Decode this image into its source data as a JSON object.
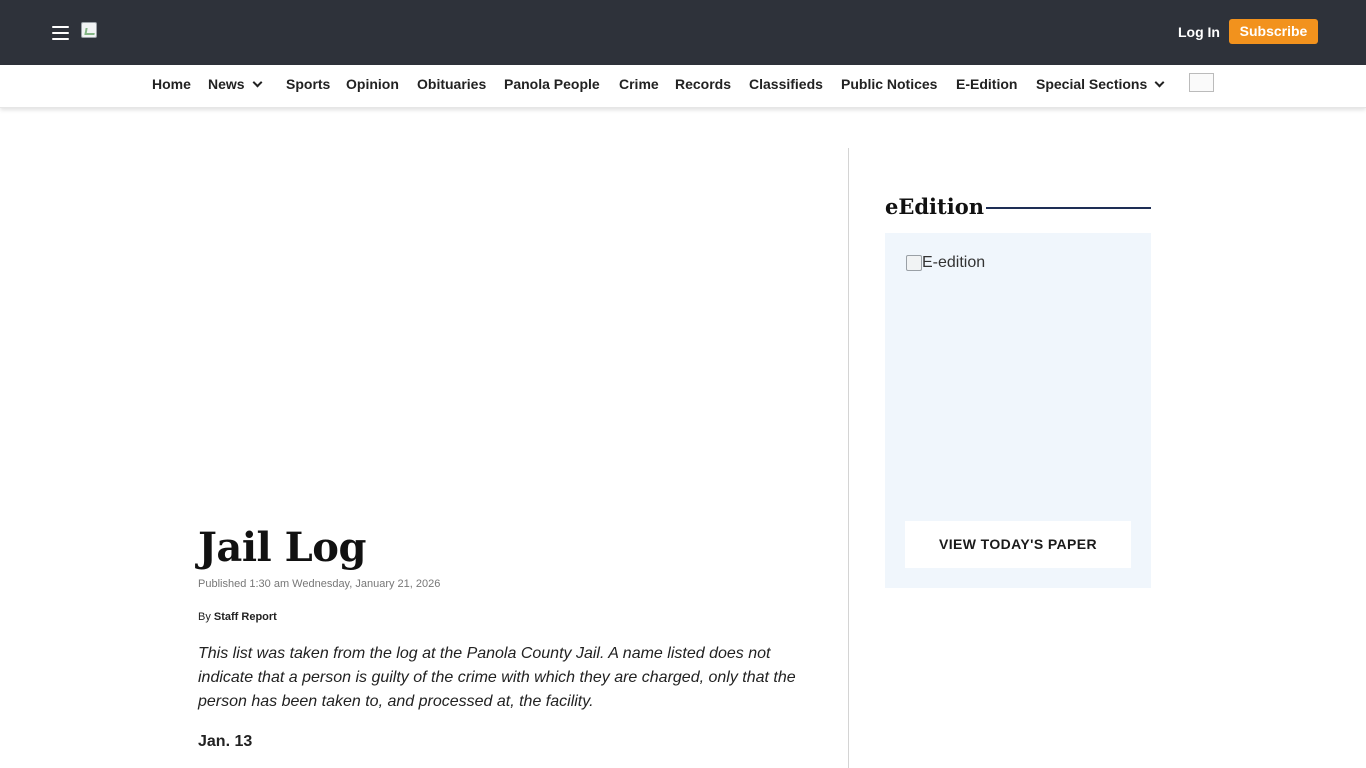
{
  "header": {
    "menu_icon": "hamburger-menu-icon",
    "logo_icon": "broken-image-icon",
    "login_label": "Log In",
    "subscribe_label": "Subscribe",
    "subscribe_color": "#f2921d",
    "bar_color": "#2e323a"
  },
  "nav": {
    "items": [
      {
        "label": "Home"
      },
      {
        "label": "News",
        "has_dropdown": true
      },
      {
        "label": "Sports"
      },
      {
        "label": "Opinion"
      },
      {
        "label": "Obituaries"
      },
      {
        "label": "Panola People"
      },
      {
        "label": "Crime"
      },
      {
        "label": "Records"
      },
      {
        "label": "Classifieds"
      },
      {
        "label": "Public Notices"
      },
      {
        "label": "E-Edition"
      },
      {
        "label": "Special Sections",
        "has_dropdown": true
      }
    ],
    "trailing_icon": "broken-image-icon"
  },
  "article": {
    "title": "Jail Log",
    "published": "Published 1:30 am Wednesday, January 21, 2026",
    "byline_prefix": "By",
    "byline_author": "Staff Report",
    "intro": "This list was taken from the log at the Panola County Jail. A name listed does not indicate that a person is guilty of the crime with which they are charged, only that the person has been taken to, and processed at, the facility.",
    "date_heading": "Jan. 13"
  },
  "sidebar": {
    "title": "eEdition",
    "rule_color": "#1e2e55",
    "image_alt": "E-edition",
    "button_label": "VIEW TODAY'S PAPER",
    "box_color": "#f0f6fc"
  }
}
